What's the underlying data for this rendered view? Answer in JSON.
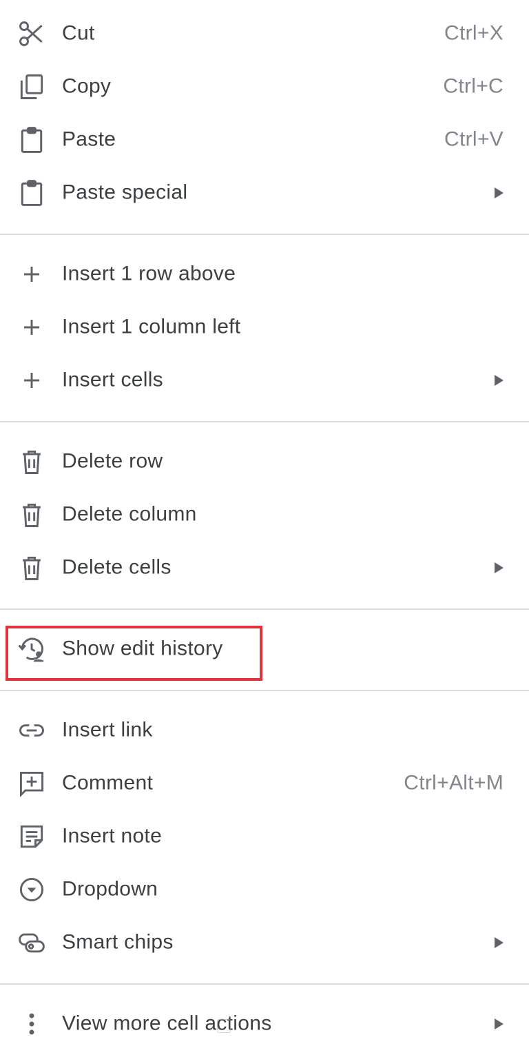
{
  "menu": {
    "items": {
      "cut": {
        "label": "Cut",
        "shortcut": "Ctrl+X",
        "icon": "scissors-icon"
      },
      "copy": {
        "label": "Copy",
        "shortcut": "Ctrl+C",
        "icon": "copy-icon"
      },
      "paste": {
        "label": "Paste",
        "shortcut": "Ctrl+V",
        "icon": "clipboard-icon"
      },
      "paste_special": {
        "label": "Paste special",
        "icon": "clipboard-icon",
        "has_submenu": true
      },
      "insert_row_above": {
        "label": "Insert 1 row above",
        "icon": "plus-icon"
      },
      "insert_column_left": {
        "label": "Insert 1 column left",
        "icon": "plus-icon"
      },
      "insert_cells": {
        "label": "Insert cells",
        "icon": "plus-icon",
        "has_submenu": true
      },
      "delete_row": {
        "label": "Delete row",
        "icon": "trash-icon"
      },
      "delete_column": {
        "label": "Delete column",
        "icon": "trash-icon"
      },
      "delete_cells": {
        "label": "Delete cells",
        "icon": "trash-icon",
        "has_submenu": true
      },
      "show_edit_history": {
        "label": "Show edit history",
        "icon": "edit-history-icon",
        "highlighted": true
      },
      "insert_link": {
        "label": "Insert link",
        "icon": "link-icon"
      },
      "comment": {
        "label": "Comment",
        "shortcut": "Ctrl+Alt+M",
        "icon": "add-comment-icon"
      },
      "insert_note": {
        "label": "Insert note",
        "icon": "note-icon"
      },
      "dropdown": {
        "label": "Dropdown",
        "icon": "dropdown-circle-icon"
      },
      "smart_chips": {
        "label": "Smart chips",
        "icon": "smart-chip-icon",
        "has_submenu": true
      },
      "view_more_cell_actions": {
        "label": "View more cell actions",
        "icon": "more-vert-icon",
        "has_submenu": true
      }
    }
  },
  "highlight_color": "#e0333a",
  "colors": {
    "text": "#3c4043",
    "shortcut": "#80868b",
    "icon": "#5f6368",
    "divider": "#dadce0"
  }
}
